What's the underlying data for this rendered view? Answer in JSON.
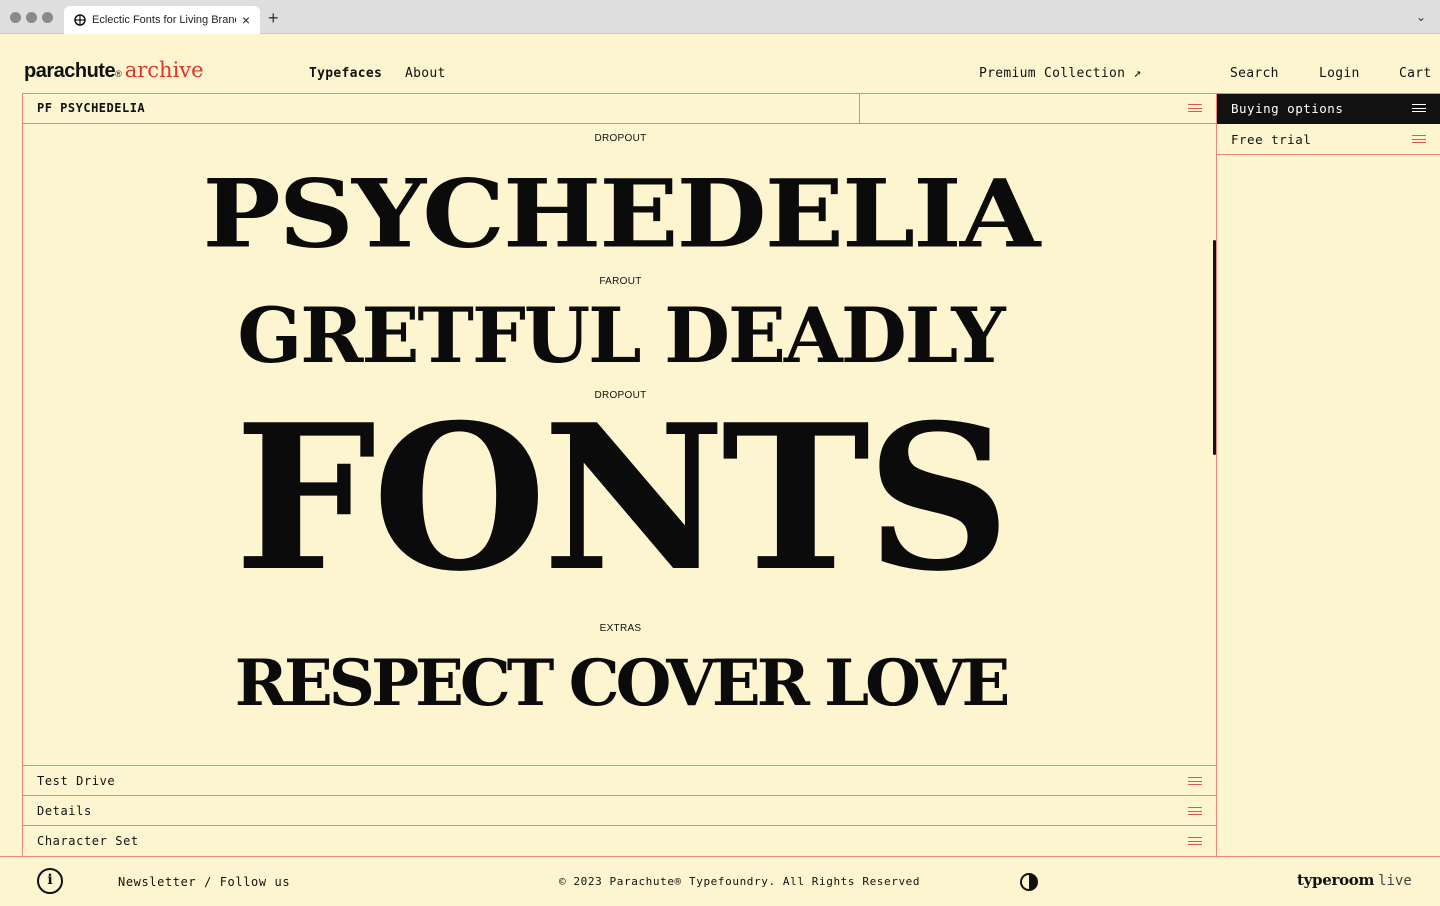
{
  "browser": {
    "tab_title": "Eclectic Fonts for Living Brands",
    "tab_close": "×",
    "new_tab": "+",
    "chevron": "⌄"
  },
  "header": {
    "brand": "parachute",
    "brand_reg": "®",
    "brand_sub": "archive",
    "nav": {
      "typefaces": "Typefaces",
      "about": "About",
      "premium": "Premium Collection ↗",
      "search": "Search",
      "login": "Login",
      "cart": "Cart"
    }
  },
  "font_bar": {
    "name": "PF PSYCHEDELIA"
  },
  "specimens": [
    {
      "label": "DROPOUT",
      "text": "PSYCHEDELIA"
    },
    {
      "label": "FAROUT",
      "text": "GRETFUL DEADLY"
    },
    {
      "label": "DROPOUT",
      "text": "FONTS"
    },
    {
      "label": "EXTRAS",
      "text": "RESPECT COVER LOVE"
    }
  ],
  "accordion": [
    {
      "label": "Test Drive"
    },
    {
      "label": "Details"
    },
    {
      "label": "Character Set"
    }
  ],
  "sidebar": {
    "buying_options": "Buying options",
    "free_trial": "Free trial"
  },
  "footer": {
    "info": "i",
    "links": "Newsletter / Follow us",
    "copyright": "© 2023 Parachute® Typefoundry. All Rights Reserved",
    "typeroom": "typeroom",
    "live": "live"
  },
  "colors": {
    "background": "#fdf5cf",
    "accent_red": "#e0332b",
    "rule": "#e8867d",
    "ink": "#111111"
  }
}
